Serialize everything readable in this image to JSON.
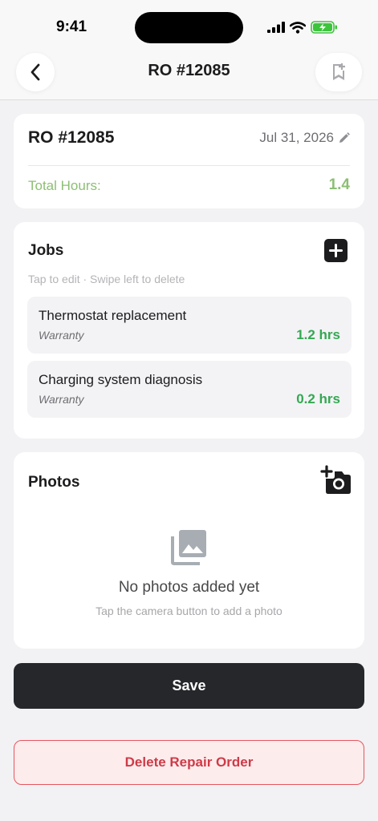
{
  "status_bar": {
    "time": "9:41",
    "icons": [
      "signal-icon",
      "wifi-icon",
      "battery-charging-icon"
    ]
  },
  "nav": {
    "title": "RO #12085",
    "back_icon": "chevron-left-icon",
    "bookmark_icon": "bookmark-add-icon"
  },
  "header": {
    "ro_number": "RO #12085",
    "date": "Jul 31, 2026",
    "edit_icon": "pencil-icon",
    "total_label": "Total Hours:",
    "total_value": "1.4"
  },
  "jobs": {
    "title": "Jobs",
    "hint": "Tap to edit · Swipe left to delete",
    "add_icon": "plus-square-icon",
    "items": [
      {
        "name": "Thermostat replacement",
        "type": "Warranty",
        "hours": "1.2 hrs"
      },
      {
        "name": "Charging system diagnosis",
        "type": "Warranty",
        "hours": "0.2 hrs"
      }
    ]
  },
  "photos": {
    "title": "Photos",
    "add_icon": "add-camera-icon",
    "placeholder_icon": "photo-library-icon",
    "empty_title": "No photos added yet",
    "empty_hint": "Tap the camera button to add a photo"
  },
  "actions": {
    "save_label": "Save",
    "delete_label": "Delete Repair Order"
  },
  "colors": {
    "accent_green": "#34a853",
    "muted_green": "#8cbf73",
    "dark_button": "#25272b",
    "danger_red": "#cf3a47",
    "danger_bg": "#fdecec"
  }
}
